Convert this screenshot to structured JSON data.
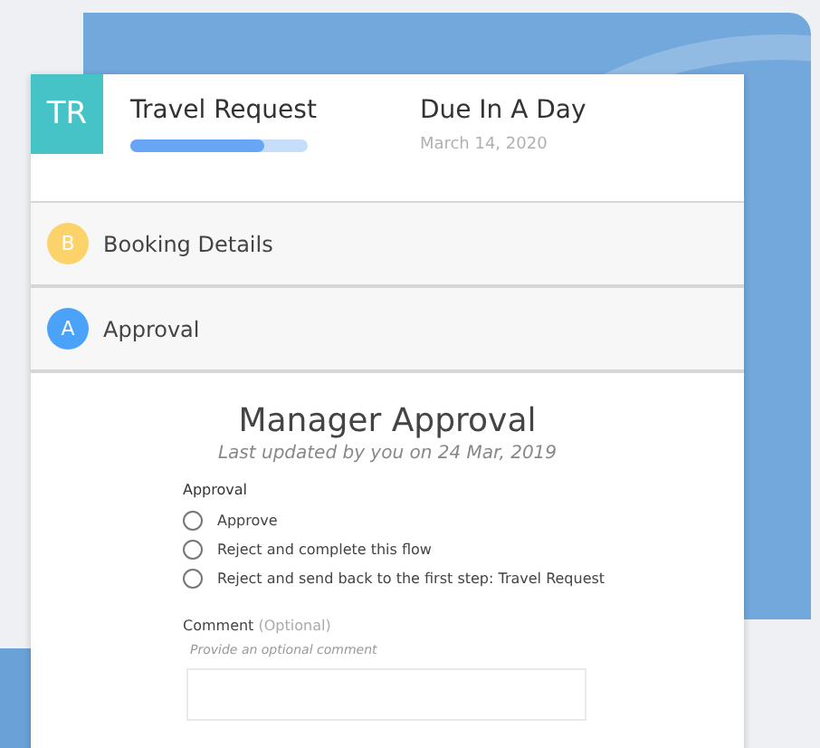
{
  "header": {
    "badge": "TR",
    "title": "Travel Request",
    "progress": {
      "level": 0.75
    },
    "due_title": "Due In A Day",
    "due_date": "March 14, 2020"
  },
  "sections": [
    {
      "letter": "B",
      "label": "Booking Details",
      "color": "#fcd36a"
    },
    {
      "letter": "A",
      "label": "Approval",
      "color": "#4aa3f8"
    }
  ],
  "form": {
    "title": "Manager Approval",
    "subtitle": "Last updated by you on 24 Mar, 2019",
    "question": "Approval",
    "options": [
      {
        "label": "Approve",
        "selected": false
      },
      {
        "label": "Reject and complete this flow",
        "selected": false
      },
      {
        "label": "Reject and send back to the first step: Travel Request",
        "selected": false
      }
    ],
    "comment": {
      "label": "Comment",
      "optional": "(Optional)",
      "hint": "Provide an optional comment"
    }
  }
}
